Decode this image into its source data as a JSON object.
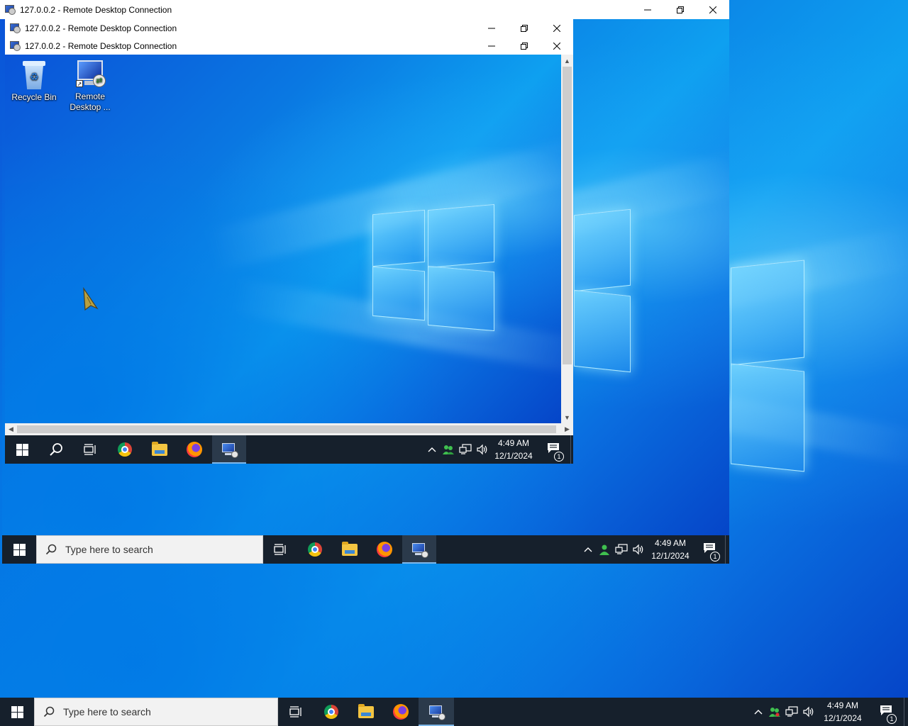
{
  "windows": {
    "outer": {
      "title": "127.0.0.2 - Remote Desktop Connection"
    },
    "middle": {
      "title": "127.0.0.2 - Remote Desktop Connection"
    },
    "inner": {
      "title": "127.0.0.2 - Remote Desktop Connection"
    }
  },
  "desktop_icons": [
    {
      "label": "Recycle Bin",
      "icon": "recycle-bin-icon"
    },
    {
      "label": "Remote Desktop ...",
      "icon": "remote-desktop-icon"
    }
  ],
  "taskbar_main": {
    "search_placeholder": "Type here to search",
    "time": "4:49 AM",
    "date": "12/1/2024",
    "notifications": "1"
  },
  "taskbar_middle": {
    "search_placeholder": "Type here to search",
    "time": "4:49 AM",
    "date": "12/1/2024",
    "notifications": "1"
  },
  "taskbar_inner": {
    "time": "4:49 AM",
    "date": "12/1/2024",
    "notifications": "1"
  },
  "taskbar_apps": [
    "task-view-icon",
    "chrome-icon",
    "file-explorer-icon",
    "firefox-icon",
    "remote-desktop-icon"
  ],
  "colors": {
    "taskbar": "#16202c",
    "wallpaper": "#0a78d7",
    "accent": "#7fb8ea"
  }
}
